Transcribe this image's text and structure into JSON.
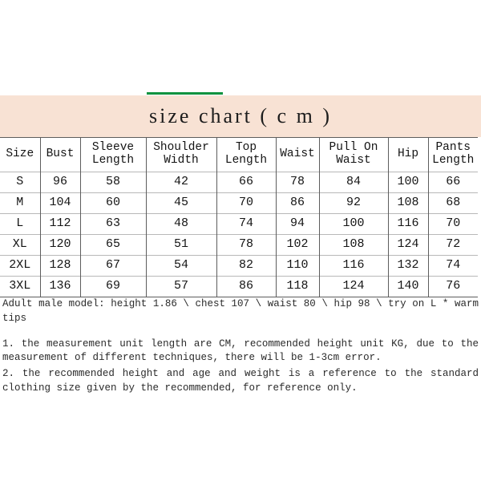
{
  "accent": {
    "green_rule_color": "#0e9340",
    "banner_color": "#f8e2d4"
  },
  "banner": {
    "title": "size chart ( c m )"
  },
  "table": {
    "columns": [
      {
        "line1": "Size",
        "line2": ""
      },
      {
        "line1": "Bust",
        "line2": ""
      },
      {
        "line1": "Sleeve",
        "line2": "Length"
      },
      {
        "line1": "Shoulder",
        "line2": "Width"
      },
      {
        "line1": "Top",
        "line2": "Length"
      },
      {
        "line1": "Waist",
        "line2": ""
      },
      {
        "line1": "Pull On",
        "line2": "Waist"
      },
      {
        "line1": "Hip",
        "line2": ""
      },
      {
        "line1": "Pants",
        "line2": "Length"
      }
    ],
    "rows": [
      [
        "S",
        "96",
        "58",
        "42",
        "66",
        "78",
        "84",
        "100",
        "66"
      ],
      [
        "M",
        "104",
        "60",
        "45",
        "70",
        "86",
        "92",
        "108",
        "68"
      ],
      [
        "L",
        "112",
        "63",
        "48",
        "74",
        "94",
        "100",
        "116",
        "70"
      ],
      [
        "XL",
        "120",
        "65",
        "51",
        "78",
        "102",
        "108",
        "124",
        "72"
      ],
      [
        "2XL",
        "128",
        "67",
        "54",
        "82",
        "110",
        "116",
        "132",
        "74"
      ],
      [
        "3XL",
        "136",
        "69",
        "57",
        "86",
        "118",
        "124",
        "140",
        "76"
      ]
    ]
  },
  "footer": {
    "model_note": "Adult male model: height 1.86 \\ chest 107 \\ waist 80 \\ hip 98 \\ try on L * warm tips",
    "note_1": "1. the measurement unit length are CM, recommended height unit KG, due to the measurement of different techniques, there will be 1-3cm error.",
    "note_2": "2. the recommended height and age and weight is a reference to the standard clothing size given by the recommended, for reference only."
  }
}
